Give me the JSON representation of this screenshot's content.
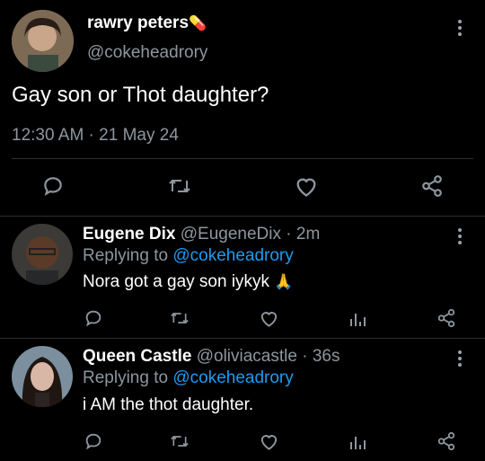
{
  "main_tweet": {
    "display_name": "rawry peters",
    "name_emoji": "💊",
    "handle": "@cokeheadrory",
    "text": "Gay son or Thot daughter?",
    "timestamp": "12:30 AM · 21 May 24"
  },
  "replies": [
    {
      "display_name": "Eugene Dix",
      "handle": "@EugeneDix",
      "time": "· 2m",
      "replying_prefix": "Replying to",
      "replying_handle": "@cokeheadrory",
      "text": "Nora got a gay son iykyk",
      "emoji": "🙏"
    },
    {
      "display_name": "Queen Castle",
      "handle": "@oliviacastle",
      "time": "· 36s",
      "replying_prefix": "Replying to",
      "replying_handle": "@cokeheadrory",
      "text": "i AM the thot daughter."
    }
  ],
  "icons": [
    "reply-icon",
    "retweet-icon",
    "like-icon",
    "analytics-icon",
    "share-icon",
    "more-icon"
  ],
  "colors": {
    "background": "#000000",
    "accent": "#1d9bf0",
    "muted": "#8d969e",
    "divider": "#2a2f33"
  }
}
